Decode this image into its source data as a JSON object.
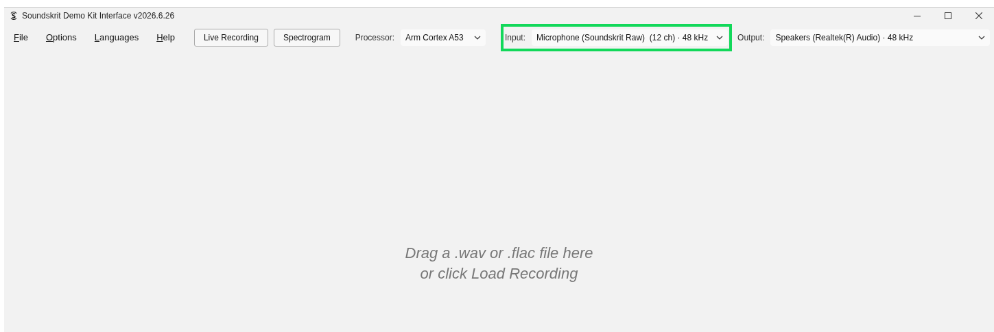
{
  "window": {
    "title": "Soundskrit Demo Kit Interface v2026.6.26"
  },
  "menu": [
    "File",
    "Options",
    "Languages",
    "Help"
  ],
  "buttons": [
    "Live Recording",
    "Spectrogram"
  ],
  "selectors": [
    {
      "label": "Processor:",
      "value": "Arm Cortex A53",
      "highlighted": false
    },
    {
      "label": "Input:",
      "value": "Microphone (Soundskrit Raw)  (12 ch) · 48 kHz",
      "highlighted": true
    },
    {
      "label": "Output:",
      "value": "Speakers (Realtek(R) Audio) · 48 kHz",
      "highlighted": false
    }
  ],
  "drop_zone": {
    "lines": [
      "Drag a .wav or .flac file here",
      "or click Load Recording"
    ]
  }
}
